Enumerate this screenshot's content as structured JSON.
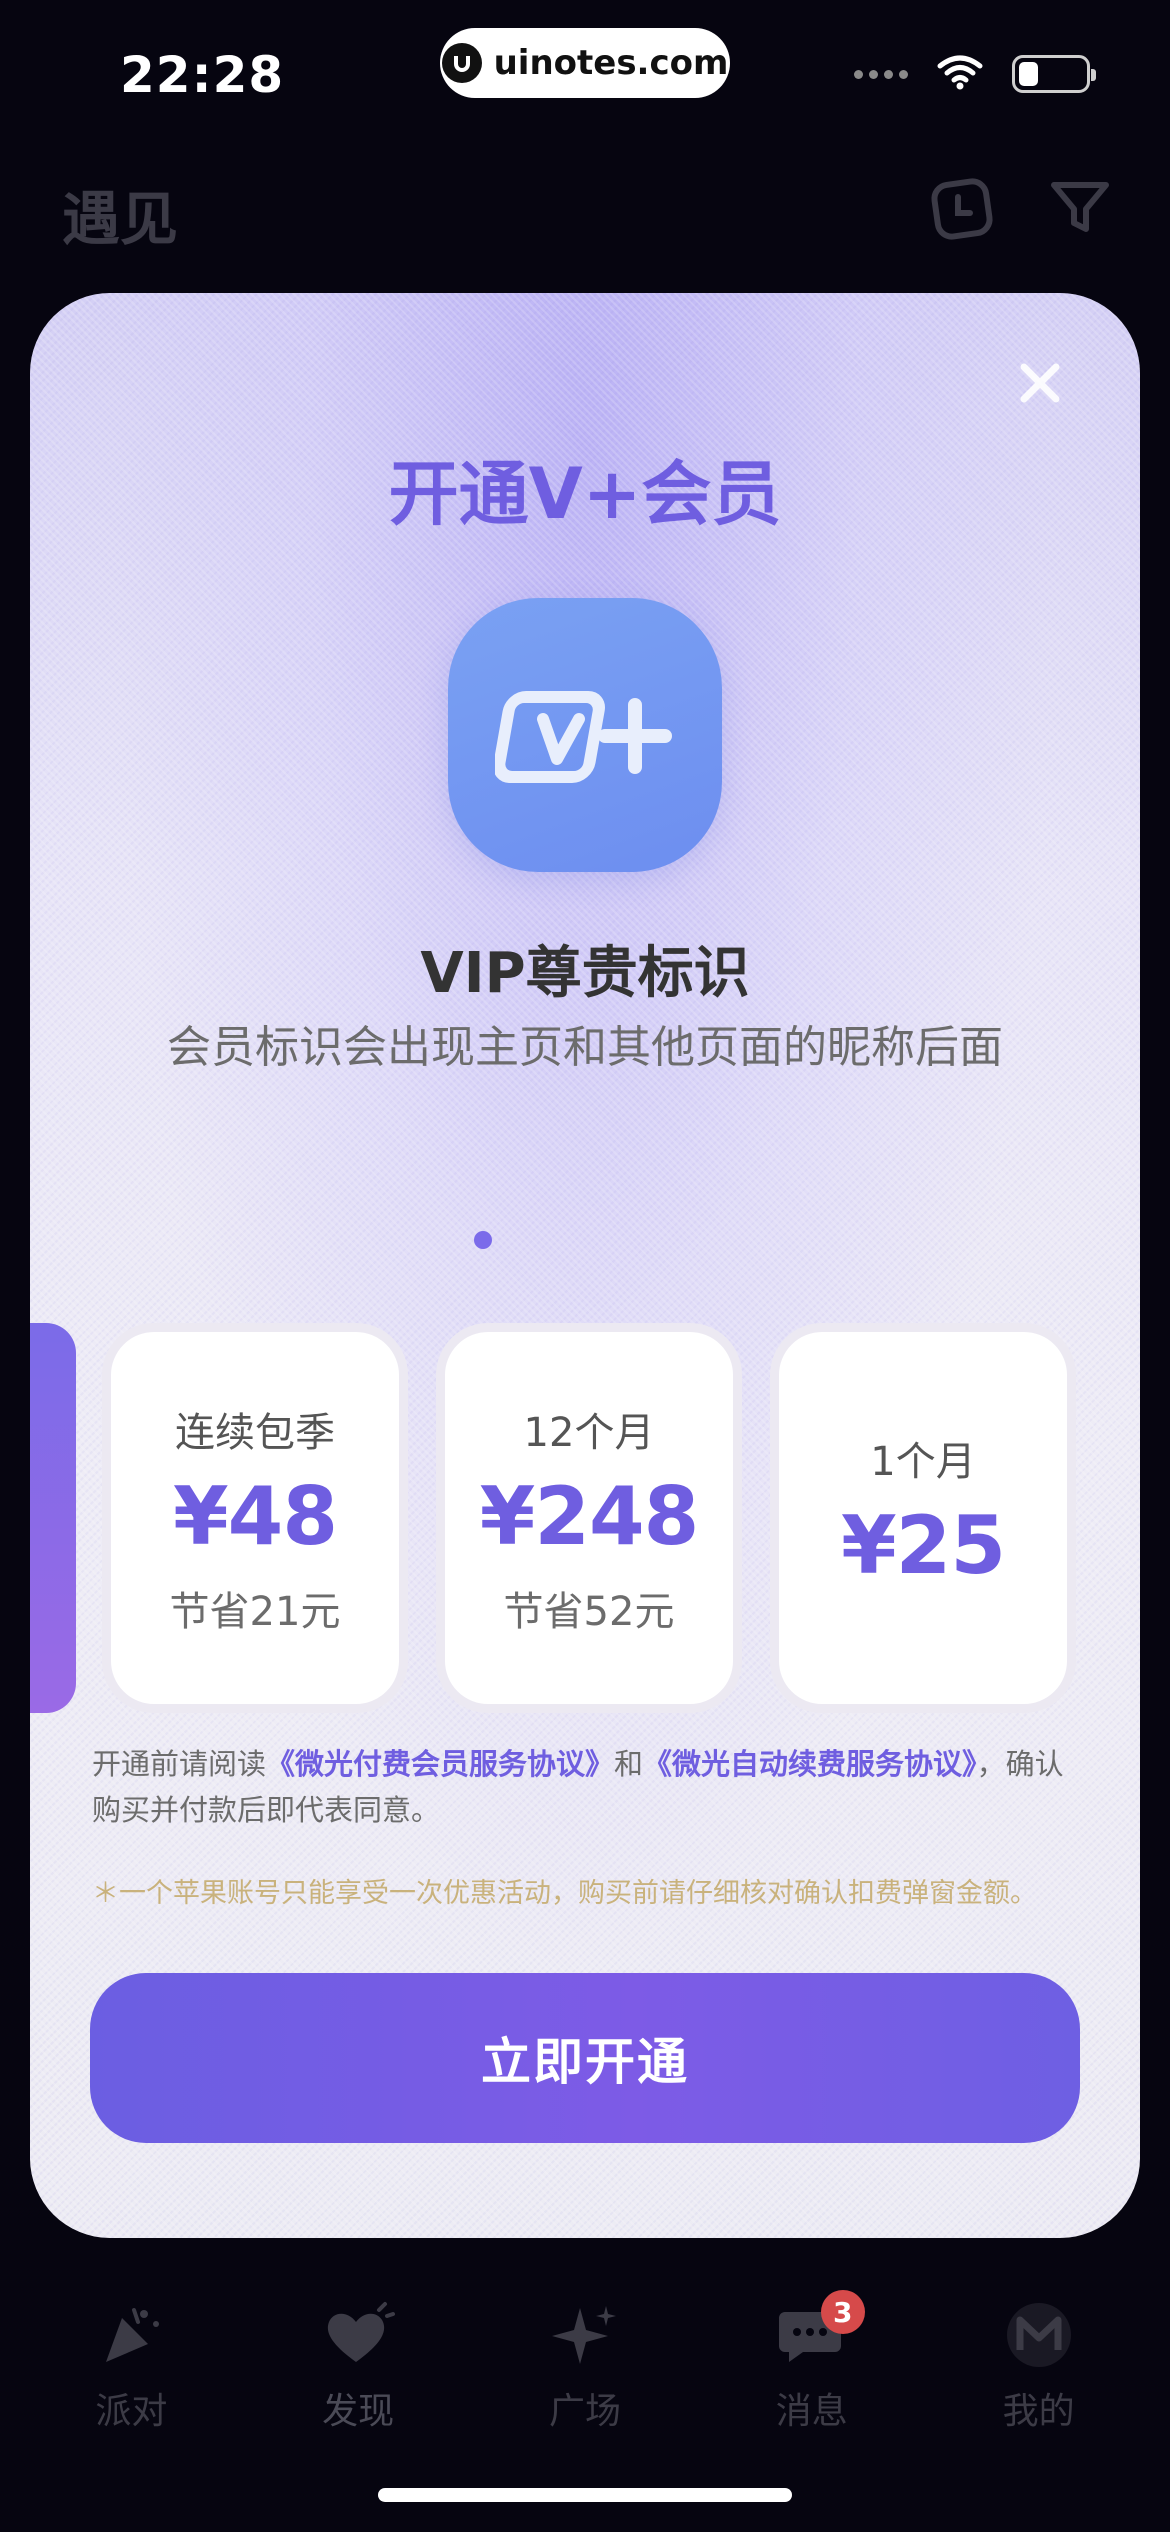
{
  "status_bar": {
    "time": "22:28",
    "url": "uinotes.com",
    "icons": [
      "cellular-signal-icon",
      "wifi-icon",
      "battery-icon"
    ],
    "battery_level": 0.3
  },
  "nav": {
    "title": "遇见",
    "icons": [
      "history-icon",
      "filter-icon"
    ]
  },
  "modal": {
    "title": "开通V+会员",
    "close_icon": "close-icon",
    "feature": {
      "icon": "vip-plus-icon",
      "title": "VIP尊贵标识",
      "description": "会员标识会出现主页和其他页面的昵称后面"
    },
    "plans": [
      {
        "name": "连续包季",
        "price": "¥48",
        "save": "节省21元"
      },
      {
        "name": "12个月",
        "price": "¥248",
        "save": "节省52元"
      },
      {
        "name": "1个月",
        "price": "¥25",
        "save": ""
      }
    ],
    "agreement": {
      "prefix": "开通前请阅读",
      "link1": "《微光付费会员服务协议》",
      "middle": "和",
      "link2": "《微光自动续费服务协议》",
      "suffix": "，确认购买并付款后即代表同意。"
    },
    "notice": "＊一个苹果账号只能享受一次优惠活动，购买前请仔细核对确认扣费弹窗金额。",
    "cta_label": "立即开通"
  },
  "tabbar": {
    "items": [
      {
        "label": "派对",
        "icon": "party-icon"
      },
      {
        "label": "发现",
        "icon": "heart-icon"
      },
      {
        "label": "广场",
        "icon": "sparkle-icon"
      },
      {
        "label": "消息",
        "icon": "message-icon",
        "badge": "3"
      },
      {
        "label": "我的",
        "icon": "profile-icon"
      }
    ]
  },
  "colors": {
    "accent": "#6f5ee0",
    "background": "#060510",
    "badge": "#d64a4a"
  }
}
